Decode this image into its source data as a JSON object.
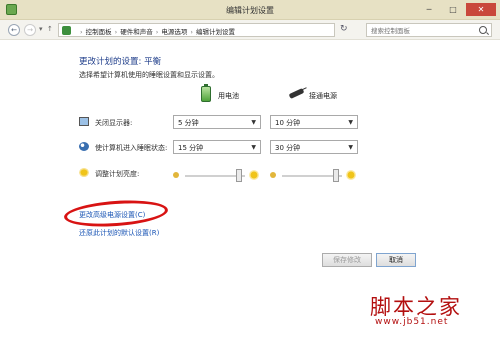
{
  "window": {
    "title": "编辑计划设置",
    "min_glyph": "─",
    "max_glyph": "□",
    "close_glyph": "✕"
  },
  "nav": {
    "back_glyph": "←",
    "forward_glyph": "→",
    "recent_glyph": "▾",
    "up_glyph": "↑",
    "breadcrumbs": [
      "控制面板",
      "硬件和声音",
      "电源选项",
      "编辑计划设置"
    ],
    "crumb_separator": "›",
    "refresh_glyph": "↻",
    "search_placeholder": "搜索控制面板"
  },
  "main": {
    "heading": "更改计划的设置: 平衡",
    "subheading": "选择希望计算机使用的睡眠设置和显示设置。",
    "columns": {
      "battery": "用电池",
      "plugged": "接通电源"
    },
    "rows": [
      {
        "label": "关闭显示器:",
        "icon": "monitor-icon",
        "battery": "5 分钟",
        "plugged": "10 分钟"
      },
      {
        "label": "使计算机进入睡眠状态:",
        "icon": "sleep-icon",
        "battery": "15 分钟",
        "plugged": "30 分钟"
      }
    ],
    "brightness": {
      "label": "调整计划亮度:",
      "battery_level": 0.9,
      "plugged_level": 0.9
    },
    "advanced_link": "更改高级电源设置(C)",
    "restore_link": "还原此计划的默认设置(R)"
  },
  "buttons": {
    "save": "保存修改",
    "cancel": "取消"
  },
  "watermark": {
    "text": "脚本之家",
    "url": "www.jb51.net"
  },
  "colors": {
    "heading": "#1e3d8a",
    "link": "#1a55b5",
    "annotation": "#d81313",
    "watermark": "#b30f0f"
  }
}
